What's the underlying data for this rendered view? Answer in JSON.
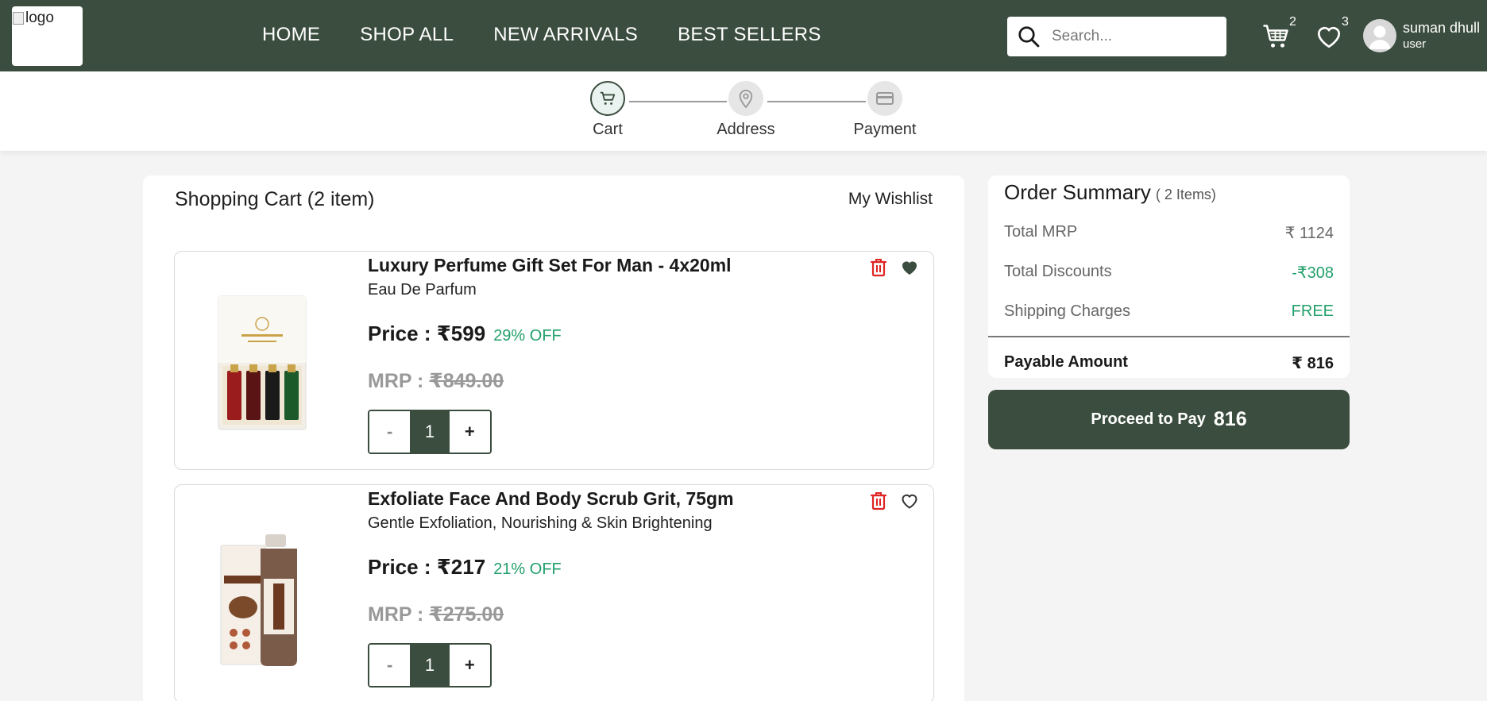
{
  "header": {
    "logo_alt": "logo",
    "nav": [
      "HOME",
      "SHOP ALL",
      "NEW ARRIVALS",
      "BEST SELLERS"
    ],
    "search_placeholder": "Search...",
    "cart_count": "2",
    "wishlist_count": "3",
    "user_name": "suman dhull",
    "user_role": "user",
    "icons": {
      "search": "search-icon",
      "cart": "cart-icon",
      "wishlist": "heart-icon",
      "avatar": "user-avatar-icon"
    }
  },
  "stepper": {
    "steps": [
      {
        "label": "Cart",
        "icon": "cart-icon",
        "active": true
      },
      {
        "label": "Address",
        "icon": "location-pin-icon",
        "active": false
      },
      {
        "label": "Payment",
        "icon": "credit-card-icon",
        "active": false
      }
    ]
  },
  "cart": {
    "title": "Shopping Cart (2 item)",
    "wishlist_link": "My Wishlist",
    "items": [
      {
        "name": "Luxury Perfume Gift Set For Man - 4x20ml",
        "description": "Eau De Parfum",
        "price_label": "Price : ₹599",
        "discount": "29% OFF",
        "mrp_prefix": "MRP : ",
        "mrp_value": "₹849.00",
        "qty_minus": "-",
        "quantity": "1",
        "qty_plus": "+",
        "wishlisted": true
      },
      {
        "name": "Exfoliate Face And Body Scrub Grit, 75gm",
        "description": "Gentle Exfoliation, Nourishing & Skin Brightening",
        "price_label": "Price : ₹217",
        "discount": "21% OFF",
        "mrp_prefix": "MRP : ",
        "mrp_value": "₹275.00",
        "qty_minus": "-",
        "quantity": "1",
        "qty_plus": "+",
        "wishlisted": false
      }
    ]
  },
  "summary": {
    "title": "Order Summary",
    "count": "( 2 Items)",
    "rows": [
      {
        "label": "Total MRP",
        "value": "₹ 1124"
      },
      {
        "label": "Total Discounts",
        "value": "-₹308"
      },
      {
        "label": "Shipping Charges",
        "value": "FREE"
      }
    ],
    "payable_label": "Payable Amount",
    "payable_value": "₹ 816",
    "pay_button_label": "Proceed to Pay",
    "pay_button_amount": "816"
  },
  "colors": {
    "brand": "#3b4d3f",
    "green": "#22a06b",
    "delete": "#e02424",
    "background": "#f4f4f4"
  }
}
